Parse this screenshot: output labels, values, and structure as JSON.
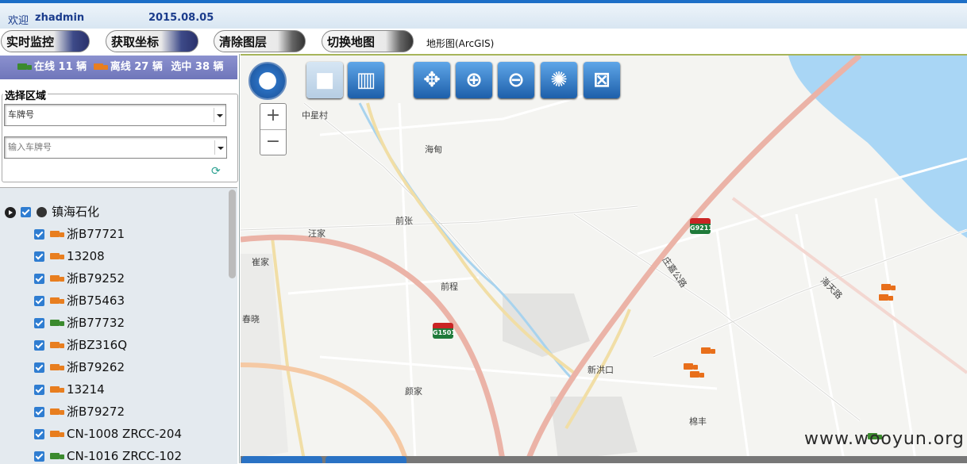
{
  "header": {
    "welcome": "欢迎",
    "user": "zhadmin",
    "date": "2015.08.05"
  },
  "toolbar": {
    "realtime_label": "实时监控",
    "getcoord_label": "获取坐标",
    "clearlayer_label": "清除图层",
    "switchmap_label": "切换地图",
    "map_type": "地形图(ArcGIS)"
  },
  "status": {
    "online": "在线 11 辆",
    "offline": "离线 27 辆",
    "selected": "选中 38 辆"
  },
  "region": {
    "legend": "选择区域",
    "select_value": "车牌号",
    "plate_placeholder": "输入车牌号"
  },
  "tree": {
    "org": "镇海石化",
    "items": [
      {
        "label": "浙B77721",
        "color": "#e87e1f"
      },
      {
        "label": "13208",
        "color": "#e87e1f"
      },
      {
        "label": "浙B79252",
        "color": "#e87e1f"
      },
      {
        "label": "浙B75463",
        "color": "#e87e1f"
      },
      {
        "label": "浙B77732",
        "color": "#3b8a2e"
      },
      {
        "label": "浙BZ316Q",
        "color": "#e87e1f"
      },
      {
        "label": "浙B79262",
        "color": "#e87e1f"
      },
      {
        "label": "13214",
        "color": "#e87e1f"
      },
      {
        "label": "浙B79272",
        "color": "#e87e1f"
      },
      {
        "label": "CN-1008 ZRCC-204",
        "color": "#e87e1f"
      },
      {
        "label": "CN-1016 ZRCC-102",
        "color": "#3b8a2e"
      }
    ]
  },
  "map": {
    "places": {
      "zhongxingcun": "中星村",
      "haidian": "海甸",
      "qianzhang": "前张",
      "wangjia": "汪家",
      "cuijia": "崔家",
      "qiancheng": "前程",
      "chunxiao": "春晓",
      "xinhongkou": "新洪口",
      "yanjia": "颜家",
      "mianfeng": "棉丰",
      "haitianlu": "海天路",
      "road_vertical": "庄嘉公路"
    },
    "shields": {
      "g9211": "G9211",
      "g1501": "G1501"
    },
    "tools": [
      "pan-icon",
      "stop-icon",
      "trash-icon",
      "move-icon",
      "zoom-in-icon",
      "zoom-out-icon",
      "full-extent-icon",
      "clear-icon"
    ]
  },
  "watermark": "www.wooyun.org"
}
